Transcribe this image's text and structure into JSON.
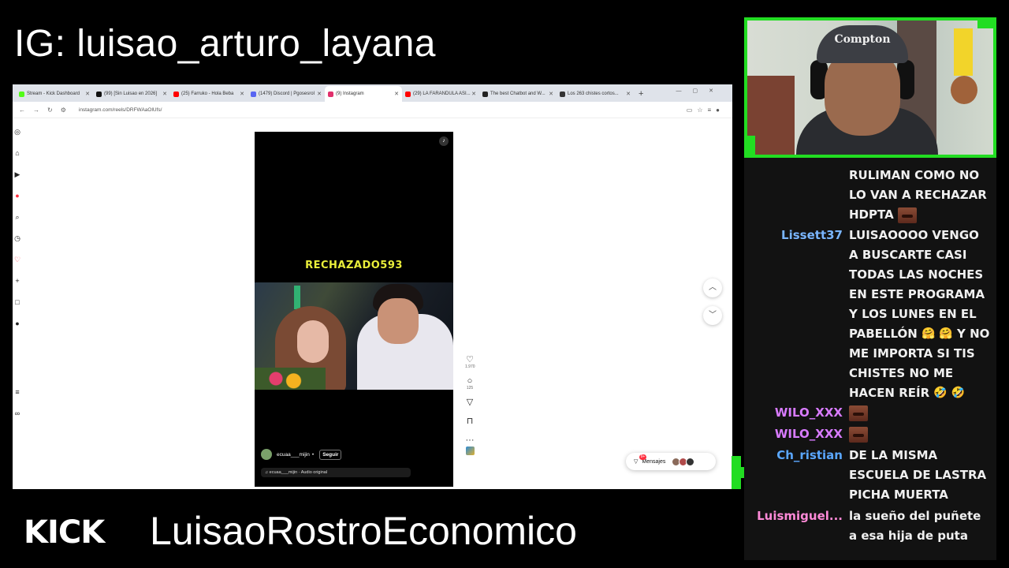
{
  "overlay": {
    "ig_handle": "IG: luisao_arturo_layana",
    "brand": "KICK",
    "channel_name": "LuisaoRostroEconomico",
    "accent_color": "#22dd22"
  },
  "browser": {
    "tabs": [
      {
        "label": "Stream - Kick Dashboard",
        "icon": "kick-icon",
        "color": "#53fc18"
      },
      {
        "label": "(99) [Sin Luisao en 2026]",
        "icon": "tiktok-icon",
        "color": "#111111"
      },
      {
        "label": "(25) Farruko - Hola Beba",
        "icon": "youtube-icon",
        "color": "#ff0000"
      },
      {
        "label": "(1479) Discord | Pgosesrol",
        "icon": "discord-icon",
        "color": "#5865f2"
      },
      {
        "label": "(9) Instagram",
        "icon": "instagram-icon",
        "color": "#e1306c"
      },
      {
        "label": "(29) LA FARANDULA ASI...",
        "icon": "youtube-icon",
        "color": "#ff0000"
      },
      {
        "label": "The best Chatbot and W...",
        "icon": "chatbot-icon",
        "color": "#222222"
      },
      {
        "label": "Los 263 chistes cortos...",
        "icon": "doc-icon",
        "color": "#333333"
      }
    ],
    "new_tab_label": "+",
    "url": "instagram.com/reels/DRFWAaOlUfs/"
  },
  "reel": {
    "overlay_text": "RECHAZADO593",
    "author": "ecuaa___mijin",
    "separator": "•",
    "follow_label": "Seguir",
    "audio": "ecuaa___mijin · Audio original",
    "likes": "1.970",
    "comments": "125",
    "more": "···"
  },
  "messages_widget": {
    "label": "Mensajes",
    "badge": "9+"
  },
  "webcam": {
    "cap_text": "Compton"
  },
  "chat": {
    "messages": [
      {
        "user": "",
        "user_color": "#ffffff",
        "text": "RULIMAN COMO NO LO VAN A RECHAZAR HDPTA",
        "emotes": 1
      },
      {
        "user": "Lissett37",
        "user_color": "#7ab6ff",
        "text": "LUISAOOOO VENGO A BUSCARTE CASI TODAS LAS NOCHES EN ESTE PROGRAMA Y LOS LUNES EN EL PABELLÓN",
        "emoji_a": "🤗 🤗",
        "text_b": " Y NO ME IMPORTA SI TIS CHISTES NO ME HACEN REÍR",
        "emoji_b": "🤣 🤣"
      },
      {
        "user": "WILO_XXX",
        "user_color": "#d87bff",
        "text": "",
        "emotes": 1
      },
      {
        "user": "WILO_XXX",
        "user_color": "#d87bff",
        "text": "",
        "emotes": 1
      },
      {
        "user": "Ch_ristian",
        "user_color": "#5aa7ff",
        "text": "DE LA MISMA ESCUELA DE LASTRA PICHA MUERTA"
      },
      {
        "user": "Luismiguel...",
        "user_color": "#ff8ad8",
        "text": "la sueño del puñete a esa hija de puta"
      }
    ]
  }
}
